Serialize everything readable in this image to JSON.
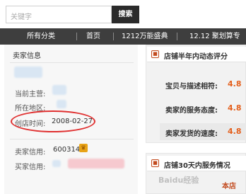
{
  "search": {
    "placeholder": "关键字",
    "button_label": "搜索"
  },
  "nav": {
    "items": [
      "所有分类",
      "首页",
      "1212万能盛典",
      "12.12 聚划算专"
    ]
  },
  "seller_info": {
    "title": "卖家信息",
    "main_business_label": "当前主营:",
    "location_label": "所在地区:",
    "open_time_label": "创店时间:",
    "open_time_value": "2008-02-27",
    "seller_credit_label": "卖家信用:",
    "seller_credit_value": "600314",
    "buyer_credit_label": "买家信用:"
  },
  "ratings": {
    "title": "店铺半年内动态评分",
    "rows": [
      {
        "label": "宝贝与描述相符:",
        "value": "4.8"
      },
      {
        "label": "卖家的服务态度:",
        "value": "4.8"
      },
      {
        "label": "卖家发货的速度:",
        "value": "4.8"
      }
    ]
  },
  "service": {
    "title": "店铺30天内服务情况",
    "store_label": "本店"
  },
  "watermark": "Baidu经验",
  "colors": {
    "nav_bg": "#3e3e3e",
    "accent": "#e4601d",
    "highlight": "#e03030"
  }
}
